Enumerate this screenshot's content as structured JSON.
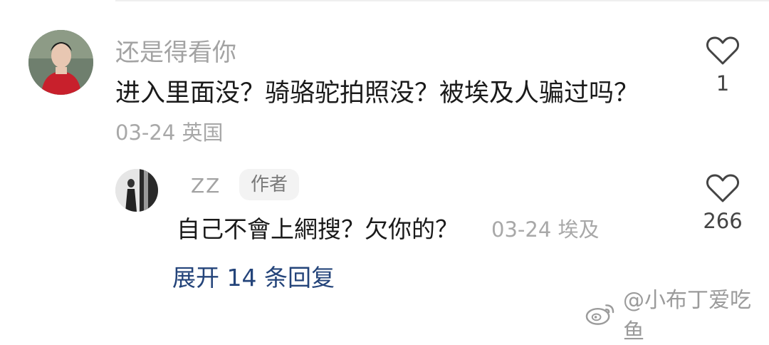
{
  "comment": {
    "username": "还是得看你",
    "text": "进入里面没？骑骆驼拍照没？被埃及人骗过吗？",
    "meta": "03-24 英国",
    "like_count": "1"
  },
  "reply": {
    "username": "ZZ",
    "badge": "作者",
    "text": "自己不會上網搜？欠你的？",
    "meta": "03-24 埃及",
    "like_count": "266"
  },
  "expand_replies": "展开 14 条回复",
  "watermark": {
    "text": "@小布丁爱吃鱼",
    "icon": "weibo-icon"
  },
  "colors": {
    "link": "#24447a",
    "muted": "#a3a3a3",
    "text": "#1a1a1a"
  }
}
